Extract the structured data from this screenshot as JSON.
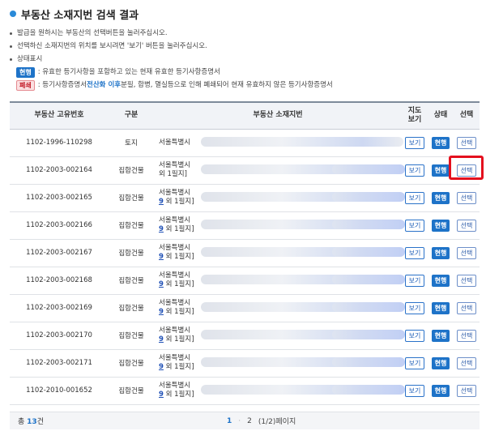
{
  "title": "부동산 소재지번 검색 결과",
  "notes": {
    "line1": "발급을 원하시는 부동산의 선택버튼을 눌러주십시오.",
    "line2": "선택하신 소재지번의 위치를 보시려면 '보기' 버튼을 눌러주십시오.",
    "line3": "상태표시",
    "legend_current_tag": "현행",
    "legend_current_text": ": 유효한 등기사항을 포함하고 있는 현재 유효한 등기사항증명서",
    "legend_closed_tag": "폐쇄",
    "legend_closed_text_a": ": 등기사항증명서 ",
    "legend_closed_highlight": "전산화 이후",
    "legend_closed_text_b": " 분필, 합병, 멸실등으로 인해 폐쇄되어 현재 유효하지 않은 등기사항증명서"
  },
  "table": {
    "headers": {
      "id": "부동산 고유번호",
      "type": "구분",
      "address": "부동산 소재지번",
      "map": "지도\n보기",
      "state": "상태",
      "select": "선택"
    },
    "rows": [
      {
        "id": "1102-1996-110298",
        "type": "토지",
        "addr1": "서울특별시 ",
        "addr_link": "",
        "addr2": "",
        "map": "보기",
        "state": "현행",
        "select": "선택"
      },
      {
        "id": "1102-2003-002164",
        "type": "집합건물",
        "addr1": "서울특별시 ",
        "addr_link": "",
        "addr2": "외 1필지]",
        "map": "보기",
        "state": "현행",
        "select": "선택"
      },
      {
        "id": "1102-2003-002165",
        "type": "집합건물",
        "addr1": "서울특별시 ",
        "addr_link": "9",
        "addr2": " 외 1필지]",
        "map": "보기",
        "state": "현행",
        "select": "선택"
      },
      {
        "id": "1102-2003-002166",
        "type": "집합건물",
        "addr1": "서울특별시 ",
        "addr_link": "9",
        "addr2": " 외 1필지]",
        "map": "보기",
        "state": "현행",
        "select": "선택"
      },
      {
        "id": "1102-2003-002167",
        "type": "집합건물",
        "addr1": "서울특별시 ",
        "addr_link": "9",
        "addr2": " 외 1필지]",
        "map": "보기",
        "state": "현행",
        "select": "선택"
      },
      {
        "id": "1102-2003-002168",
        "type": "집합건물",
        "addr1": "서울특별시 ",
        "addr_link": "9",
        "addr2": " 외 1필지]",
        "map": "보기",
        "state": "현행",
        "select": "선택"
      },
      {
        "id": "1102-2003-002169",
        "type": "집합건물",
        "addr1": "서울특별시 ",
        "addr_link": "9",
        "addr2": " 외 1필지]",
        "map": "보기",
        "state": "현행",
        "select": "선택"
      },
      {
        "id": "1102-2003-002170",
        "type": "집합건물",
        "addr1": "서울특별시 ",
        "addr_link": "9",
        "addr2": " 외 1필지]",
        "map": "보기",
        "state": "현행",
        "select": "선택"
      },
      {
        "id": "1102-2003-002171",
        "type": "집합건물",
        "addr1": "서울특별시 ",
        "addr_link": "9",
        "addr2": " 외 1필지]",
        "map": "보기",
        "state": "현행",
        "select": "선택"
      },
      {
        "id": "1102-2010-001652",
        "type": "집합건물",
        "addr1": "서울특별시 ",
        "addr_link": "9",
        "addr2": " 외 1필지]",
        "map": "보기",
        "state": "현행",
        "select": "선택"
      }
    ]
  },
  "footer": {
    "total_label": "총 ",
    "total_count": "13",
    "total_unit": "건",
    "page_current": "1",
    "page_next": "2",
    "page_info": "(1/2)페이지"
  },
  "colors": {
    "accent": "#1e73c8",
    "highlight_frame": "#e4101e"
  }
}
